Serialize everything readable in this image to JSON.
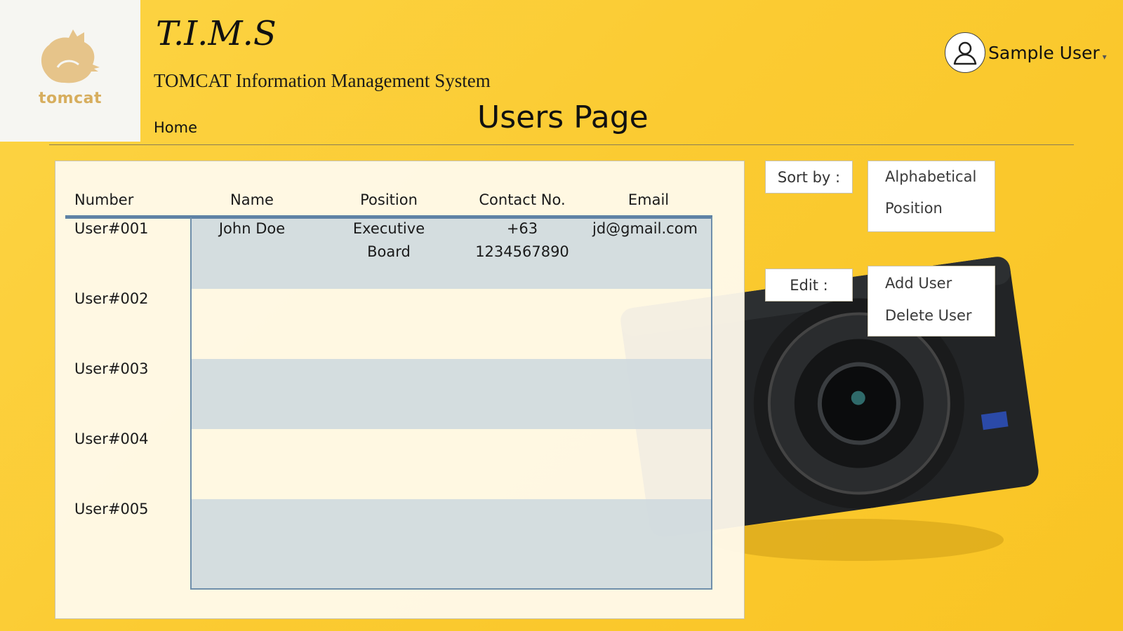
{
  "app": {
    "logo_text": "tomcat",
    "brand": "T.I.M.S",
    "subtitle": "TOMCAT Information Management System"
  },
  "nav": {
    "home": "Home"
  },
  "page": {
    "title": "Users Page"
  },
  "user_menu": {
    "name": "Sample User",
    "caret": "▾"
  },
  "table": {
    "headers": [
      "Number",
      "Name",
      "Position",
      "Contact No.",
      "Email"
    ],
    "rows": [
      {
        "number": "User#001",
        "name": "John Doe",
        "position_line1": "Executive",
        "position_line2": "Board",
        "contact_line1": "+63",
        "contact_line2": "1234567890",
        "email": "jd@gmail.com"
      },
      {
        "number": "User#002"
      },
      {
        "number": "User#003"
      },
      {
        "number": "User#004"
      },
      {
        "number": "User#005"
      }
    ]
  },
  "sort": {
    "label": "Sort by :",
    "options": [
      "Alphabetical",
      "Position"
    ]
  },
  "edit": {
    "label": "Edit :",
    "options": [
      "Add User",
      "Delete User"
    ]
  },
  "colors": {
    "accent_rule": "#5f82a5",
    "stripe": "#cdd8de",
    "background": "#fbcb32"
  }
}
